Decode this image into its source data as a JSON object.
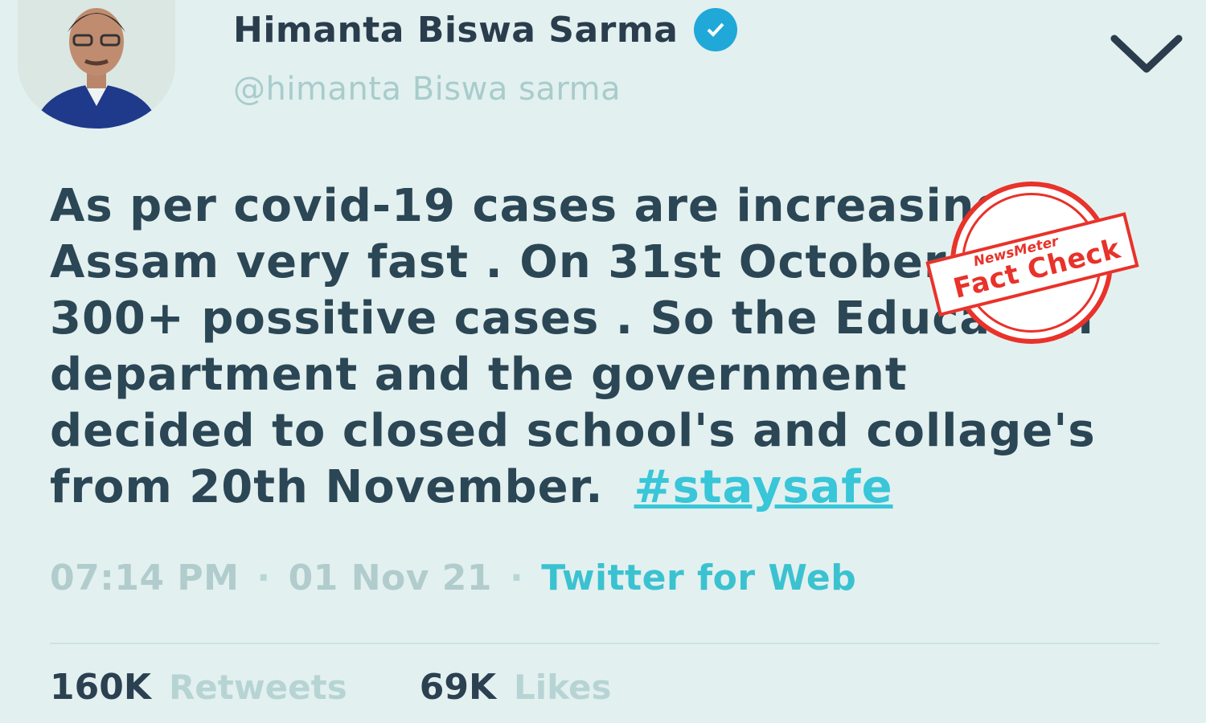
{
  "tweet": {
    "author_name": "Himanta Biswa Sarma",
    "handle": "@himanta Biswa sarma",
    "text": "As per covid-19 cases are increasing in Assam very fast . On 31st October it 300+ possitive cases . So the Education department and the government decided to closed school's and collage's from 20th November.",
    "hashtag": "#staysafe",
    "time": "07:14 PM",
    "date": "01 Nov 21",
    "source": "Twitter for Web",
    "retweets_count": "160K",
    "retweets_label": "Retweets",
    "likes_count": "69K",
    "likes_label": "Likes"
  },
  "icons": {
    "avatar": "profile-photo",
    "verified": "verified-badge-icon",
    "menu": "chevron-down-icon"
  },
  "stamp": {
    "brand": "NewsMeter",
    "label": "Fact Check"
  },
  "colors": {
    "background": "#e3f0f0",
    "text": "#2b4654",
    "accent": "#38c6d8",
    "verified": "#20a8d8",
    "stamp": "#e8322a"
  }
}
